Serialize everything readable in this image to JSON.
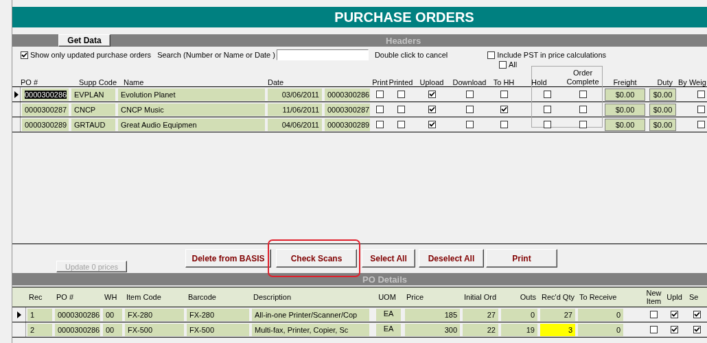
{
  "title": "PURCHASE ORDERS",
  "headers_section": {
    "title": "Headers",
    "get_data_button": "Get Data",
    "show_updated": {
      "label": "Show only updated purchase orders",
      "checked": true
    },
    "search": {
      "label": "Search (Number or Name or Date )"
    },
    "search_hint": "Double click to cancel",
    "include_pst": {
      "label": "Include PST in price calculations",
      "checked": false
    },
    "all": {
      "label": "All",
      "checked": false
    },
    "columns": [
      "PO #",
      "Supp Code",
      "Name",
      "Date",
      "Print",
      "Printed",
      "Upload",
      "Download",
      "To HH",
      "Hold",
      "Order Complete",
      "Freight",
      "Duty",
      "By Weig"
    ],
    "rows": [
      {
        "selected": true,
        "po": "0000300286",
        "supp_code": "EVPLAN",
        "name": "Evolution Planet",
        "date": "03/06/2011",
        "po_ref": "0000300286",
        "print": false,
        "printed": false,
        "upload": true,
        "download": false,
        "to_hh": false,
        "hold": false,
        "complete": false,
        "freight": "$0.00",
        "duty": "$0.00",
        "by_weight": false
      },
      {
        "selected": false,
        "po": "0000300287",
        "supp_code": "CNCP",
        "name": "CNCP Music",
        "date": "11/06/2011",
        "po_ref": "0000300287",
        "print": false,
        "printed": false,
        "upload": true,
        "download": false,
        "to_hh": true,
        "hold": false,
        "complete": false,
        "freight": "$0.00",
        "duty": "$0.00",
        "by_weight": false
      },
      {
        "selected": false,
        "po": "0000300289",
        "supp_code": "GRTAUD",
        "name": "Great Audio Equipmen",
        "date": "04/06/2011",
        "po_ref": "0000300289",
        "print": false,
        "printed": false,
        "upload": true,
        "download": false,
        "to_hh": false,
        "hold": false,
        "complete": false,
        "freight": "$0.00",
        "duty": "$0.00",
        "by_weight": false
      }
    ]
  },
  "actions": {
    "update_prices": {
      "label": "Update 0 prices",
      "disabled": true
    },
    "buttons": [
      {
        "label": "Delete from BASIS",
        "highlighted": false
      },
      {
        "label": "Check Scans",
        "highlighted": true
      },
      {
        "label": "Select All",
        "highlighted": false
      },
      {
        "label": "Deselect All",
        "highlighted": false
      },
      {
        "label": "Print",
        "highlighted": false
      }
    ]
  },
  "details_section": {
    "title": "PO Details",
    "columns": [
      "Rec",
      "PO #",
      "WH",
      "Item Code",
      "Barcode",
      "Description",
      "UOM",
      "Price",
      "Initial Ord",
      "Outs",
      "Rec'd Qty",
      "To Receive",
      "New Item",
      "Upld",
      "Se"
    ],
    "rows": [
      {
        "selected": true,
        "rec": "1",
        "po": "0000300286",
        "wh": "00",
        "item_code": "FX-280",
        "barcode": "FX-280",
        "description": "All-in-one Printer/Scanner/Cop",
        "uom": "EA",
        "price": "185",
        "initial_ord": "27",
        "outs": "0",
        "recd_qty": "27",
        "recd_flagged": false,
        "to_receive": "0",
        "new_item": false,
        "upld": true,
        "sel": true
      },
      {
        "selected": false,
        "rec": "2",
        "po": "0000300286",
        "wh": "00",
        "item_code": "FX-500",
        "barcode": "FX-500",
        "description": "Multi-fax, Printer, Copier, Sc",
        "uom": "EA",
        "price": "300",
        "initial_ord": "22",
        "outs": "19",
        "recd_qty": "3",
        "recd_flagged": true,
        "to_receive": "0",
        "new_item": false,
        "upld": true,
        "sel": true
      }
    ]
  }
}
